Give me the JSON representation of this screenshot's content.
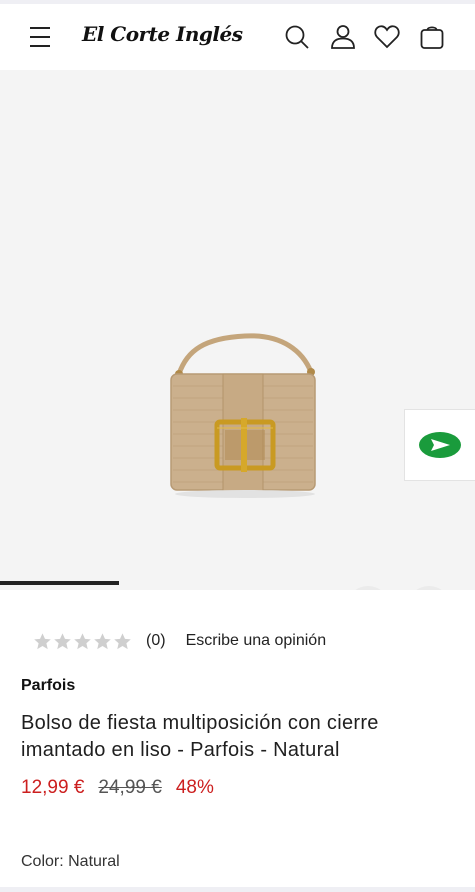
{
  "header": {
    "logo_text": "El Corte Inglés",
    "icons": [
      "menu-icon",
      "search-icon",
      "account-icon",
      "heart-icon",
      "bag-icon"
    ]
  },
  "gallery": {
    "image_description_icon": "product-image",
    "progress_fraction": 0.25
  },
  "product": {
    "rating_count": "(0)",
    "write_review_label": "Escribe una opinión",
    "stars_filled": 0,
    "brand": "Parfois",
    "title": "Bolso de fiesta multiposición con cierre imantado en liso - Parfois - Natural",
    "price_current": "12,99 €",
    "price_original": "24,99 €",
    "discount": "48%",
    "color_label": "Color: Natural"
  },
  "colors": {
    "price": "#cc1f1f",
    "chat_green": "#1a9b3c"
  }
}
